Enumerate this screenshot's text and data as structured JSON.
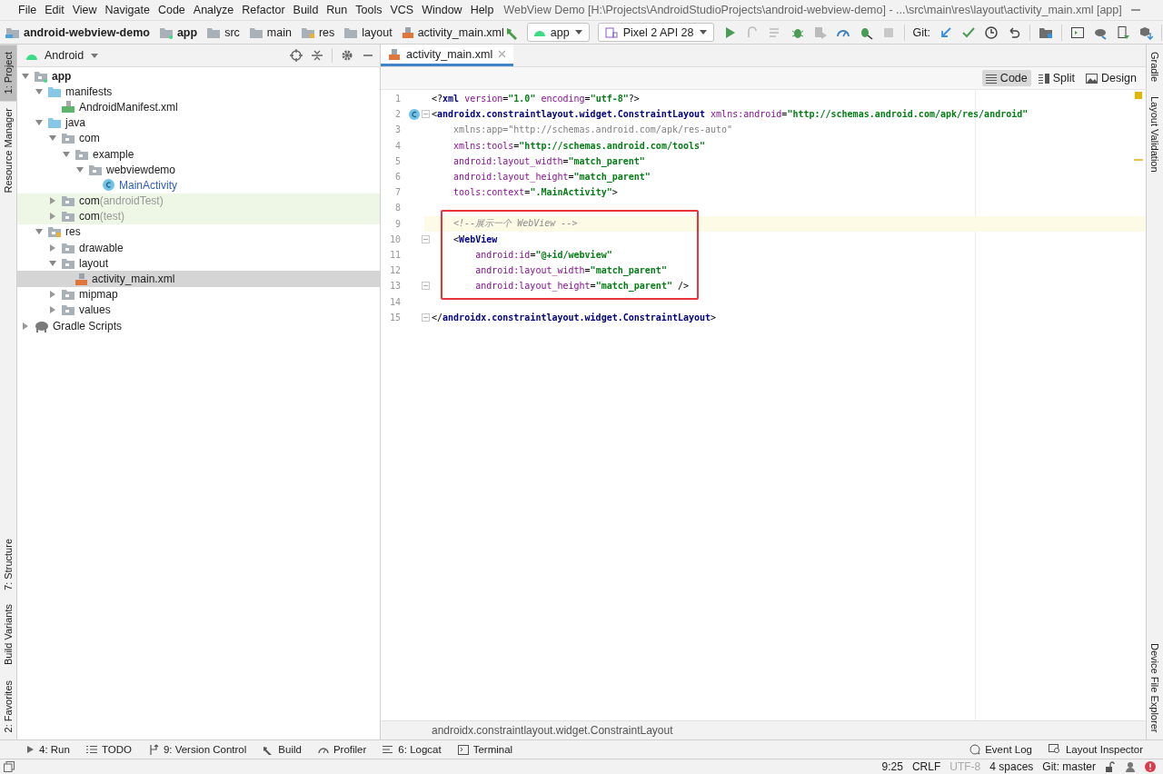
{
  "menu": [
    "File",
    "Edit",
    "View",
    "Navigate",
    "Code",
    "Analyze",
    "Refactor",
    "Build",
    "Run",
    "Tools",
    "VCS",
    "Window",
    "Help"
  ],
  "window": {
    "title": "WebView Demo [H:\\Projects\\AndroidStudioProjects\\android-webview-demo] - ...\\src\\main\\res\\layout\\activity_main.xml [app]"
  },
  "breadcrumbs": [
    {
      "label": "android-webview-demo",
      "kind": "project"
    },
    {
      "label": "app",
      "kind": "module"
    },
    {
      "label": "src",
      "kind": "folder"
    },
    {
      "label": "main",
      "kind": "folder"
    },
    {
      "label": "res",
      "kind": "res"
    },
    {
      "label": "layout",
      "kind": "folder"
    },
    {
      "label": "activity_main.xml",
      "kind": "xml"
    }
  ],
  "toolbar": {
    "run_config": "app",
    "device": "Pixel 2 API 28",
    "git_label": "Git:"
  },
  "left_strip": {
    "top": [
      {
        "label": "1: Project",
        "selected": true
      },
      {
        "label": "Resource Manager",
        "selected": false
      }
    ],
    "bottom": [
      {
        "label": "7: Structure",
        "selected": false
      },
      {
        "label": "Build Variants",
        "selected": false
      },
      {
        "label": "2: Favorites",
        "selected": false
      }
    ]
  },
  "right_strip": {
    "top": [
      "Gradle",
      "Layout Validation"
    ],
    "bottom": [
      "Device File Explorer"
    ]
  },
  "project_panel": {
    "view": "Android",
    "tree": [
      {
        "name": "app",
        "kind": "module",
        "expanded": true,
        "selected": false,
        "children": [
          {
            "name": "manifests",
            "kind": "source-folder",
            "expanded": true,
            "selected": false,
            "children": [
              {
                "name": "AndroidManifest.xml",
                "kind": "manifest",
                "selected": false
              }
            ]
          },
          {
            "name": "java",
            "kind": "source-folder",
            "expanded": true,
            "selected": false,
            "children": [
              {
                "name": "com",
                "kind": "package",
                "expanded": true,
                "selected": false,
                "children": [
                  {
                    "name": "example",
                    "kind": "package",
                    "expanded": true,
                    "selected": false,
                    "children": [
                      {
                        "name": "webviewdemo",
                        "kind": "package",
                        "expanded": true,
                        "selected": false,
                        "children": [
                          {
                            "name": "MainActivity",
                            "kind": "class",
                            "selected": false
                          }
                        ]
                      }
                    ]
                  }
                ]
              },
              {
                "name": "com",
                "suffix": "(androidTest)",
                "kind": "test-package",
                "expanded": false,
                "selected": false
              },
              {
                "name": "com",
                "suffix": "(test)",
                "kind": "test-package",
                "expanded": false,
                "selected": false
              }
            ]
          },
          {
            "name": "res",
            "kind": "res",
            "expanded": true,
            "selected": false,
            "children": [
              {
                "name": "drawable",
                "kind": "package",
                "expanded": false,
                "selected": false
              },
              {
                "name": "layout",
                "kind": "package",
                "expanded": true,
                "selected": false,
                "children": [
                  {
                    "name": "activity_main.xml",
                    "kind": "xml",
                    "selected": true
                  }
                ]
              },
              {
                "name": "mipmap",
                "kind": "package",
                "expanded": false,
                "selected": false
              },
              {
                "name": "values",
                "kind": "package",
                "expanded": false,
                "selected": false
              }
            ]
          }
        ]
      },
      {
        "name": "Gradle Scripts",
        "kind": "gradle",
        "expanded": false,
        "selected": false
      }
    ]
  },
  "editor": {
    "tabs": [
      {
        "label": "activity_main.xml",
        "selected": true
      }
    ],
    "modes": [
      {
        "label": "Code",
        "kind": "code",
        "selected": true
      },
      {
        "label": "Split",
        "kind": "split",
        "selected": false
      },
      {
        "label": "Design",
        "kind": "design",
        "selected": false
      }
    ],
    "lines": [
      {
        "number": "1",
        "segments": [
          {
            "text": "<?",
            "kind": "punct"
          },
          {
            "text": "xml",
            "kind": "tag"
          },
          {
            "text": " version",
            "kind": "attr"
          },
          {
            "text": "=",
            "kind": "punct"
          },
          {
            "text": "\"1.0\"",
            "kind": "value"
          },
          {
            "text": " encoding",
            "kind": "attr"
          },
          {
            "text": "=",
            "kind": "punct"
          },
          {
            "text": "\"utf-8\"",
            "kind": "value"
          },
          {
            "text": "?>",
            "kind": "punct"
          }
        ]
      },
      {
        "number": "2",
        "class_marker": true,
        "fold": true,
        "segments": [
          {
            "text": "<",
            "kind": "punct"
          },
          {
            "text": "androidx.constraintlayout.widget.ConstraintLayout",
            "kind": "tag"
          },
          {
            "text": " xmlns:android",
            "kind": "attr"
          },
          {
            "text": "=",
            "kind": "punct"
          },
          {
            "text": "\"http://schemas.android.com/apk/res/android\"",
            "kind": "value"
          }
        ]
      },
      {
        "number": "3",
        "segments": [
          {
            "text": "    xmlns:app=\"http://schemas.android.com/apk/res-auto\"",
            "kind": "unused"
          }
        ]
      },
      {
        "number": "4",
        "segments": [
          {
            "text": "    xmlns:tools",
            "kind": "attr"
          },
          {
            "text": "=",
            "kind": "punct"
          },
          {
            "text": "\"http://schemas.android.com/tools\"",
            "kind": "value"
          }
        ]
      },
      {
        "number": "5",
        "segments": [
          {
            "text": "    android:layout_width",
            "kind": "attr"
          },
          {
            "text": "=",
            "kind": "punct"
          },
          {
            "text": "\"match_parent\"",
            "kind": "value"
          }
        ]
      },
      {
        "number": "6",
        "segments": [
          {
            "text": "    android:layout_height",
            "kind": "attr"
          },
          {
            "text": "=",
            "kind": "punct"
          },
          {
            "text": "\"match_parent\"",
            "kind": "value"
          }
        ]
      },
      {
        "number": "7",
        "segments": [
          {
            "text": "    tools:context",
            "kind": "attr"
          },
          {
            "text": "=",
            "kind": "punct"
          },
          {
            "text": "\".MainActivity\"",
            "kind": "value"
          },
          {
            "text": ">",
            "kind": "punct"
          }
        ]
      },
      {
        "number": "8"
      },
      {
        "number": "9",
        "current": true,
        "boxed": true,
        "segments": [
          {
            "text": "    <!--展示一个 WebView -->",
            "kind": "comment"
          }
        ]
      },
      {
        "number": "10",
        "boxed": true,
        "fold": true,
        "segments": [
          {
            "text": "    <",
            "kind": "punct"
          },
          {
            "text": "WebView",
            "kind": "tag"
          }
        ]
      },
      {
        "number": "11",
        "boxed": true,
        "segments": [
          {
            "text": "        android:id",
            "kind": "attr"
          },
          {
            "text": "=",
            "kind": "punct"
          },
          {
            "text": "\"@+id/webview\"",
            "kind": "value"
          }
        ]
      },
      {
        "number": "12",
        "boxed": true,
        "segments": [
          {
            "text": "        android:layout_width",
            "kind": "attr"
          },
          {
            "text": "=",
            "kind": "punct"
          },
          {
            "text": "\"match_parent\"",
            "kind": "value"
          }
        ]
      },
      {
        "number": "13",
        "boxed": true,
        "fold": true,
        "segments": [
          {
            "text": "        android:layout_height",
            "kind": "attr"
          },
          {
            "text": "=",
            "kind": "punct"
          },
          {
            "text": "\"match_parent\"",
            "kind": "value"
          },
          {
            "text": " />",
            "kind": "punct"
          }
        ]
      },
      {
        "number": "14"
      },
      {
        "number": "15",
        "fold": true,
        "segments": [
          {
            "text": "</",
            "kind": "punct"
          },
          {
            "text": "androidx.constraintlayout.widget.ConstraintLayout",
            "kind": "tag"
          },
          {
            "text": ">",
            "kind": "punct"
          }
        ]
      }
    ],
    "breadcrumb": "androidx.constraintlayout.widget.ConstraintLayout"
  },
  "tool_tabs": {
    "left": [
      {
        "label": "4: Run",
        "kind": "run"
      },
      {
        "label": "TODO",
        "kind": "list"
      },
      {
        "label": "9: Version Control",
        "kind": "vcs"
      },
      {
        "label": "Build",
        "kind": "build"
      },
      {
        "label": "Profiler",
        "kind": "gauge"
      },
      {
        "label": "6: Logcat",
        "kind": "logcat"
      },
      {
        "label": "Terminal",
        "kind": "terminal"
      }
    ],
    "right": [
      {
        "label": "Event Log",
        "kind": "bubble"
      },
      {
        "label": "Layout Inspector",
        "kind": "inspect"
      }
    ]
  },
  "status_bar": [
    {
      "label": "9:25",
      "disabled": false
    },
    {
      "label": "CRLF",
      "disabled": false
    },
    {
      "label": "UTF-8",
      "disabled": true
    },
    {
      "label": "4 spaces",
      "disabled": false
    },
    {
      "label": "Git: master",
      "disabled": false
    }
  ]
}
